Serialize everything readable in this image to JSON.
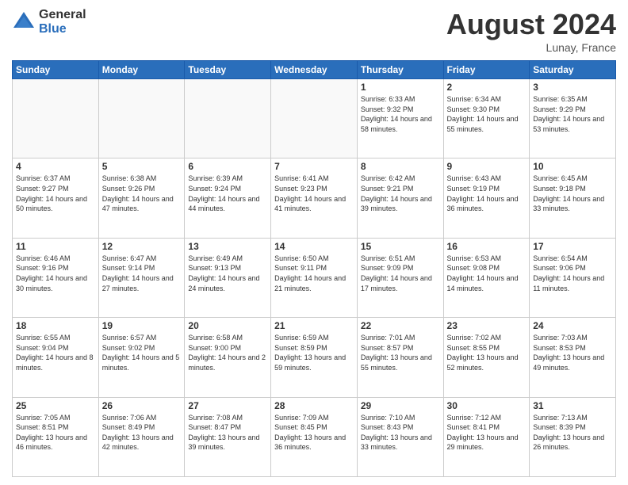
{
  "logo": {
    "general": "General",
    "blue": "Blue"
  },
  "title": "August 2024",
  "location": "Lunay, France",
  "days_of_week": [
    "Sunday",
    "Monday",
    "Tuesday",
    "Wednesday",
    "Thursday",
    "Friday",
    "Saturday"
  ],
  "weeks": [
    [
      {
        "day": "",
        "info": ""
      },
      {
        "day": "",
        "info": ""
      },
      {
        "day": "",
        "info": ""
      },
      {
        "day": "",
        "info": ""
      },
      {
        "day": "1",
        "info": "Sunrise: 6:33 AM\nSunset: 9:32 PM\nDaylight: 14 hours\nand 58 minutes."
      },
      {
        "day": "2",
        "info": "Sunrise: 6:34 AM\nSunset: 9:30 PM\nDaylight: 14 hours\nand 55 minutes."
      },
      {
        "day": "3",
        "info": "Sunrise: 6:35 AM\nSunset: 9:29 PM\nDaylight: 14 hours\nand 53 minutes."
      }
    ],
    [
      {
        "day": "4",
        "info": "Sunrise: 6:37 AM\nSunset: 9:27 PM\nDaylight: 14 hours\nand 50 minutes."
      },
      {
        "day": "5",
        "info": "Sunrise: 6:38 AM\nSunset: 9:26 PM\nDaylight: 14 hours\nand 47 minutes."
      },
      {
        "day": "6",
        "info": "Sunrise: 6:39 AM\nSunset: 9:24 PM\nDaylight: 14 hours\nand 44 minutes."
      },
      {
        "day": "7",
        "info": "Sunrise: 6:41 AM\nSunset: 9:23 PM\nDaylight: 14 hours\nand 41 minutes."
      },
      {
        "day": "8",
        "info": "Sunrise: 6:42 AM\nSunset: 9:21 PM\nDaylight: 14 hours\nand 39 minutes."
      },
      {
        "day": "9",
        "info": "Sunrise: 6:43 AM\nSunset: 9:19 PM\nDaylight: 14 hours\nand 36 minutes."
      },
      {
        "day": "10",
        "info": "Sunrise: 6:45 AM\nSunset: 9:18 PM\nDaylight: 14 hours\nand 33 minutes."
      }
    ],
    [
      {
        "day": "11",
        "info": "Sunrise: 6:46 AM\nSunset: 9:16 PM\nDaylight: 14 hours\nand 30 minutes."
      },
      {
        "day": "12",
        "info": "Sunrise: 6:47 AM\nSunset: 9:14 PM\nDaylight: 14 hours\nand 27 minutes."
      },
      {
        "day": "13",
        "info": "Sunrise: 6:49 AM\nSunset: 9:13 PM\nDaylight: 14 hours\nand 24 minutes."
      },
      {
        "day": "14",
        "info": "Sunrise: 6:50 AM\nSunset: 9:11 PM\nDaylight: 14 hours\nand 21 minutes."
      },
      {
        "day": "15",
        "info": "Sunrise: 6:51 AM\nSunset: 9:09 PM\nDaylight: 14 hours\nand 17 minutes."
      },
      {
        "day": "16",
        "info": "Sunrise: 6:53 AM\nSunset: 9:08 PM\nDaylight: 14 hours\nand 14 minutes."
      },
      {
        "day": "17",
        "info": "Sunrise: 6:54 AM\nSunset: 9:06 PM\nDaylight: 14 hours\nand 11 minutes."
      }
    ],
    [
      {
        "day": "18",
        "info": "Sunrise: 6:55 AM\nSunset: 9:04 PM\nDaylight: 14 hours\nand 8 minutes."
      },
      {
        "day": "19",
        "info": "Sunrise: 6:57 AM\nSunset: 9:02 PM\nDaylight: 14 hours\nand 5 minutes."
      },
      {
        "day": "20",
        "info": "Sunrise: 6:58 AM\nSunset: 9:00 PM\nDaylight: 14 hours\nand 2 minutes."
      },
      {
        "day": "21",
        "info": "Sunrise: 6:59 AM\nSunset: 8:59 PM\nDaylight: 13 hours\nand 59 minutes."
      },
      {
        "day": "22",
        "info": "Sunrise: 7:01 AM\nSunset: 8:57 PM\nDaylight: 13 hours\nand 55 minutes."
      },
      {
        "day": "23",
        "info": "Sunrise: 7:02 AM\nSunset: 8:55 PM\nDaylight: 13 hours\nand 52 minutes."
      },
      {
        "day": "24",
        "info": "Sunrise: 7:03 AM\nSunset: 8:53 PM\nDaylight: 13 hours\nand 49 minutes."
      }
    ],
    [
      {
        "day": "25",
        "info": "Sunrise: 7:05 AM\nSunset: 8:51 PM\nDaylight: 13 hours\nand 46 minutes."
      },
      {
        "day": "26",
        "info": "Sunrise: 7:06 AM\nSunset: 8:49 PM\nDaylight: 13 hours\nand 42 minutes."
      },
      {
        "day": "27",
        "info": "Sunrise: 7:08 AM\nSunset: 8:47 PM\nDaylight: 13 hours\nand 39 minutes."
      },
      {
        "day": "28",
        "info": "Sunrise: 7:09 AM\nSunset: 8:45 PM\nDaylight: 13 hours\nand 36 minutes."
      },
      {
        "day": "29",
        "info": "Sunrise: 7:10 AM\nSunset: 8:43 PM\nDaylight: 13 hours\nand 33 minutes."
      },
      {
        "day": "30",
        "info": "Sunrise: 7:12 AM\nSunset: 8:41 PM\nDaylight: 13 hours\nand 29 minutes."
      },
      {
        "day": "31",
        "info": "Sunrise: 7:13 AM\nSunset: 8:39 PM\nDaylight: 13 hours\nand 26 minutes."
      }
    ]
  ]
}
